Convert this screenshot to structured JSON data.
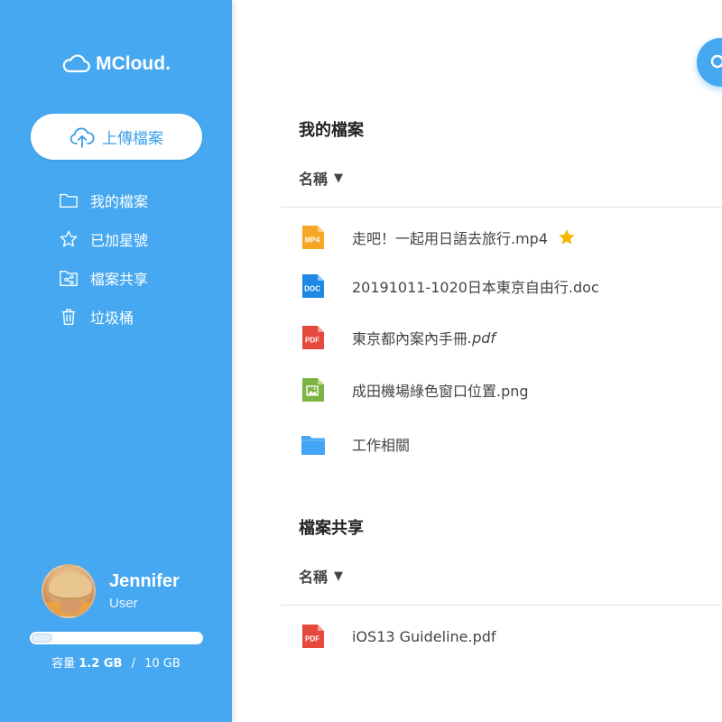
{
  "app": {
    "logo_text": "MCloud."
  },
  "sidebar": {
    "upload_label": "上傳檔案",
    "items": [
      {
        "label": "我的檔案",
        "icon": "folder-icon"
      },
      {
        "label": "已加星號",
        "icon": "star-icon"
      },
      {
        "label": "檔案共享",
        "icon": "shared-folder-icon"
      },
      {
        "label": "垃圾桶",
        "icon": "trash-icon"
      }
    ],
    "user": {
      "name": "Jennifer",
      "role": "User"
    },
    "storage": {
      "label": "容量",
      "used": "1.2 GB",
      "separator": "/",
      "total": "10 GB",
      "used_fraction": 0.12
    }
  },
  "main": {
    "my_files": {
      "title": "我的檔案",
      "column_header": "名稱",
      "sort_indicator": "▼",
      "files": [
        {
          "name": "走吧！一起用日語去旅行.mp4",
          "type": "MP4",
          "starred": true
        },
        {
          "name": "20191011-1020日本東京自由行.doc",
          "type": "DOC",
          "starred": false
        },
        {
          "name": "東京都內案內手冊",
          "ext": ".pdf",
          "type": "PDF",
          "starred": false
        },
        {
          "name": "成田機場綠色窗口位置.png",
          "type": "PNG",
          "starred": false
        },
        {
          "name": "工作相關",
          "type": "FOLDER",
          "starred": false
        }
      ]
    },
    "shared": {
      "title": "檔案共享",
      "column_header": "名稱",
      "sort_indicator": "▼",
      "files": [
        {
          "name": "iOS13 Guideline.pdf",
          "type": "PDF"
        }
      ]
    }
  },
  "colors": {
    "accent": "#45a8f0",
    "mp4": "#f5a623",
    "doc": "#1e88e5",
    "pdf": "#e5483d",
    "png": "#7cb342",
    "folder": "#42a5f5",
    "star": "#f5b800"
  }
}
